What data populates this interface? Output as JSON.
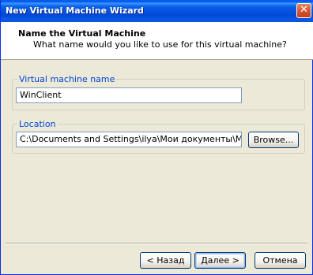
{
  "window": {
    "title": "New Virtual Machine Wizard",
    "close_symbol": "✕"
  },
  "header": {
    "title": "Name the Virtual Machine",
    "subtitle": "What name would you like to use for this virtual machine?"
  },
  "name_group": {
    "label": "Virtual machine name",
    "value": "WinClient"
  },
  "location_group": {
    "label": "Location",
    "value": "C:\\Documents and Settings\\ilya\\Мои документы\\My Virtual Ma",
    "browse_label": "Browse..."
  },
  "footer": {
    "back_label": "< Назад",
    "next_label": "Далее >",
    "cancel_label": "Отмена"
  }
}
